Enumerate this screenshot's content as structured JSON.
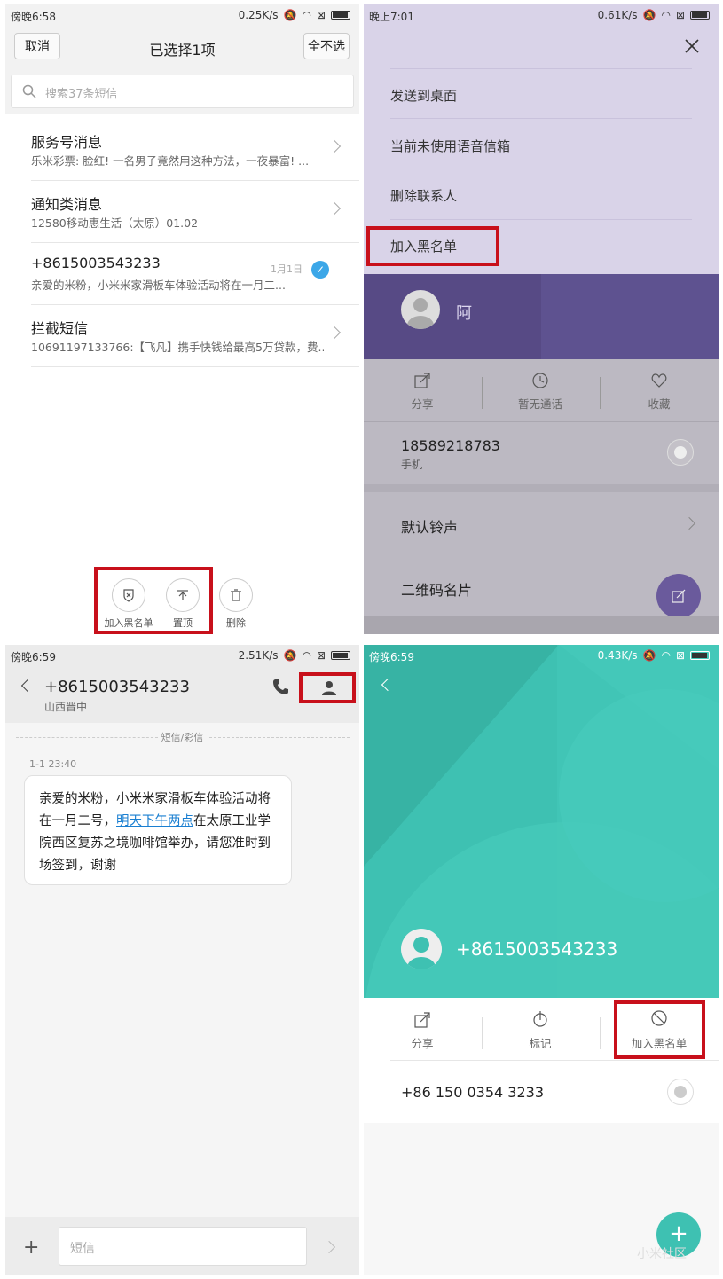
{
  "panel1": {
    "status_time": "傍晚6:58",
    "status_speed": "0.25K/s",
    "cancel_label": "取消",
    "title": "已选择1项",
    "deselect_label": "全不选",
    "search_placeholder": "搜索37条短信",
    "items": [
      {
        "title": "服务号消息",
        "subtitle": "乐米彩票: 脸红! 一名男子竟然用这种方法，一夜暴富! ...",
        "date": ""
      },
      {
        "title": "通知类消息",
        "subtitle": "12580移动惠生活（太原）01.02",
        "date": ""
      },
      {
        "title": "+8615003543233",
        "subtitle": "亲爱的米粉，小米米家滑板车体验活动将在一月二...",
        "date": "1月1日"
      },
      {
        "title": "拦截短信",
        "subtitle": "10691197133766:【飞凡】携手快钱给最高5万贷款，费...",
        "date": ""
      }
    ],
    "actions": [
      {
        "label": "加入黑名单"
      },
      {
        "label": "置顶"
      },
      {
        "label": "删除"
      }
    ]
  },
  "panel2": {
    "status_time": "晚上7:01",
    "status_speed": "0.61K/s",
    "menu": [
      "发送到桌面",
      "当前未使用语音信箱",
      "删除联系人",
      "加入黑名单"
    ],
    "contact_name": "阿",
    "actions": [
      "分享",
      "暂无通话",
      "收藏"
    ],
    "phone": "18589218783",
    "phone_type": "手机",
    "ringtone_label": "默认铃声",
    "qr_label": "二维码名片"
  },
  "panel3": {
    "status_time": "傍晚6:59",
    "status_speed": "2.51K/s",
    "number": "+8615003543233",
    "location": "山西晋中",
    "divider_label": "短信/彩信",
    "timestamp": "1-1 23:40",
    "msg_part1": "亲爱的米粉，小米米家滑板车体验活动将在一月二号，",
    "msg_link": "明天下午两点",
    "msg_part2": "在太原工业学院西区复苏之境咖啡馆举办，请您准时到场签到，谢谢",
    "input_placeholder": "短信"
  },
  "panel4": {
    "status_time": "傍晚6:59",
    "status_speed": "0.43K/s",
    "number": "+8615003543233",
    "actions": [
      "分享",
      "标记",
      "加入黑名单"
    ],
    "phone": "+86 150 0354 3233"
  },
  "watermark": "小米社区",
  "colors": {
    "accent_blue": "#3ca7e8",
    "teal": "#3ec1b2",
    "purple_header": "#574a85",
    "red_highlight": "#c8101b"
  }
}
